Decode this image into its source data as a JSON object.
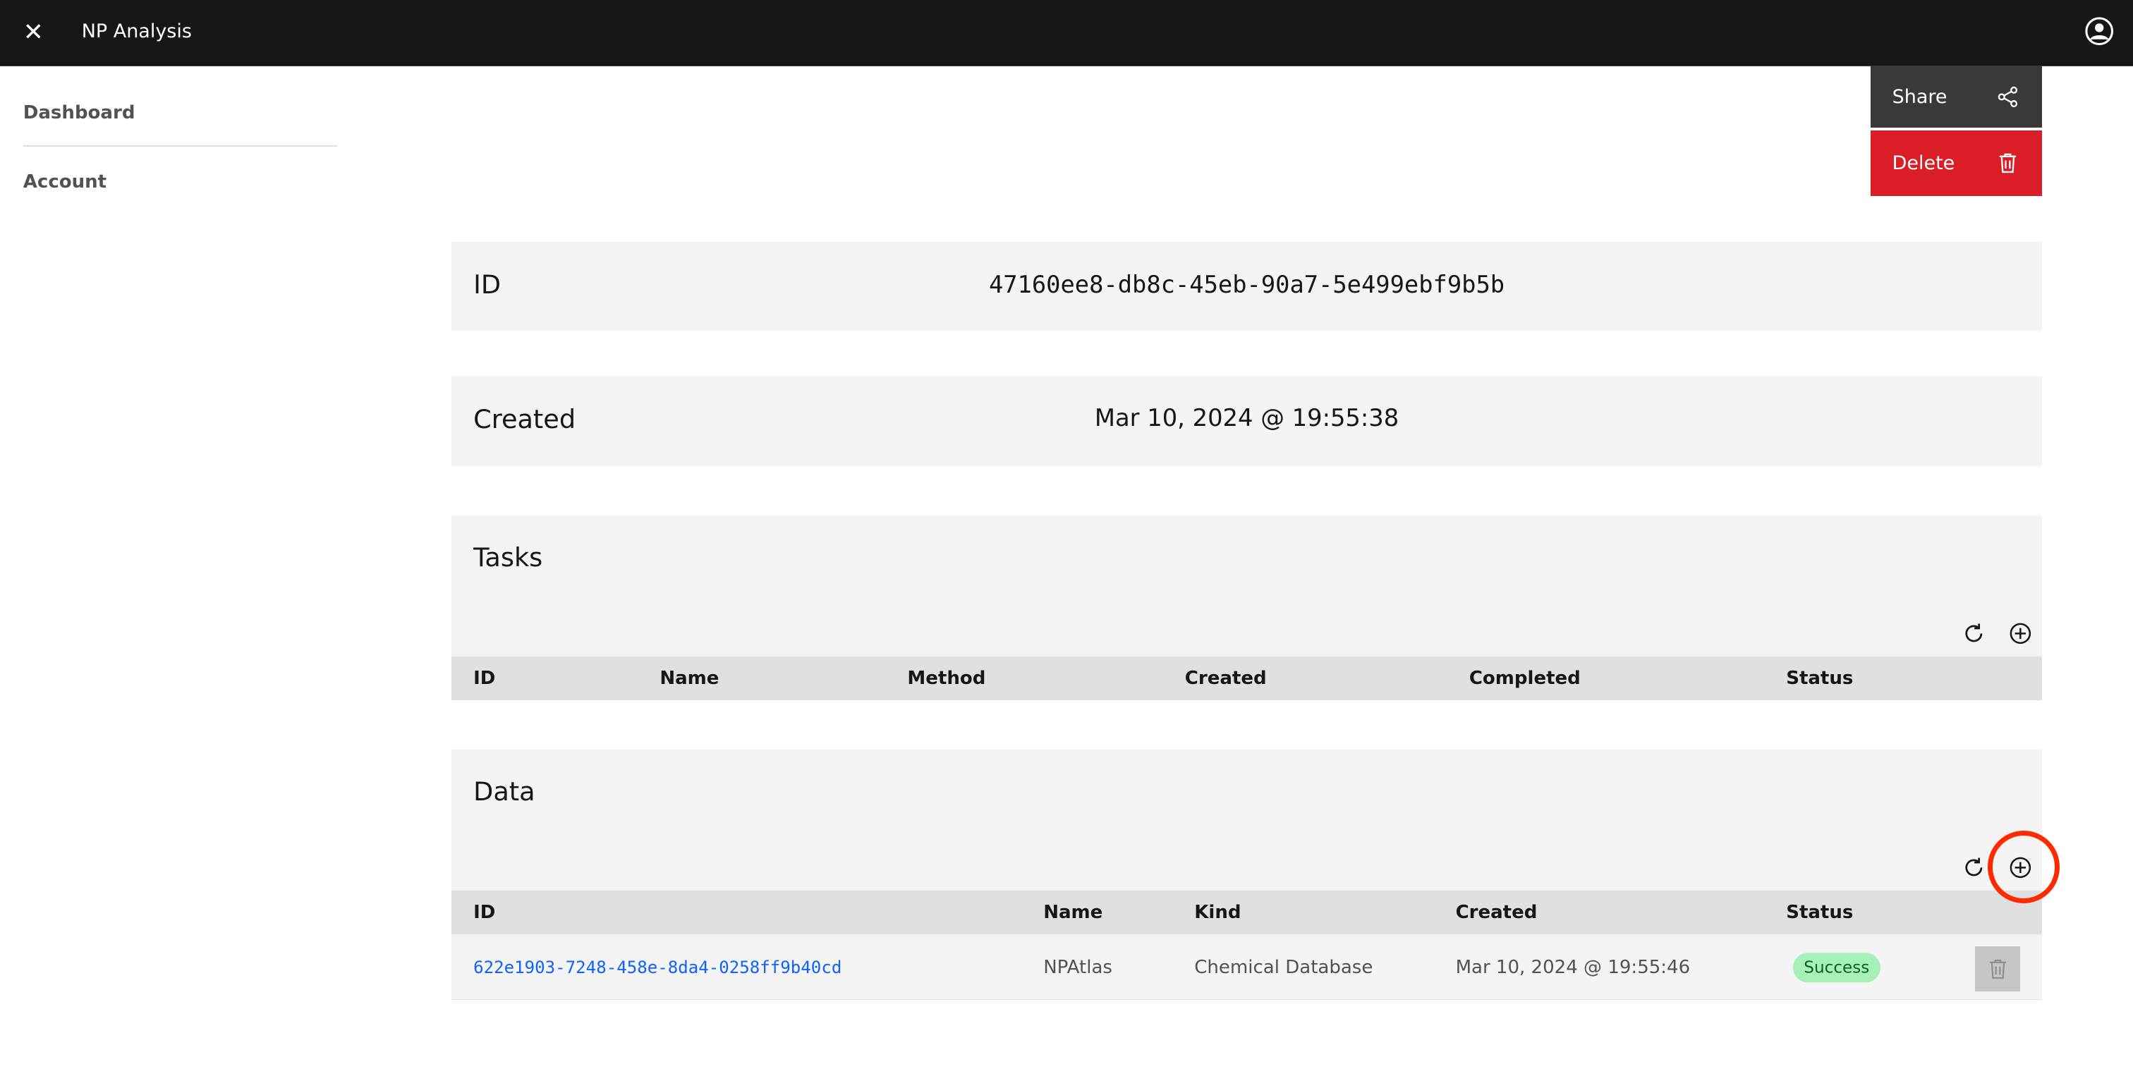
{
  "header": {
    "title": "NP Analysis",
    "close_icon": "close-icon",
    "user_icon": "user-avatar-icon"
  },
  "sidebar": {
    "items": [
      {
        "label": "Dashboard"
      },
      {
        "label": "Account"
      }
    ]
  },
  "actions": {
    "share_label": "Share",
    "delete_label": "Delete",
    "share_icon": "share-icon",
    "delete_icon": "trash-icon",
    "delete_color": "#da1e28"
  },
  "id_card": {
    "label": "ID",
    "value": "47160ee8-db8c-45eb-90a7-5e499ebf9b5b"
  },
  "created_card": {
    "label": "Created",
    "value": "Mar 10, 2024 @ 19:55:38"
  },
  "tasks": {
    "title": "Tasks",
    "columns": [
      "ID",
      "Name",
      "Method",
      "Created",
      "Completed",
      "Status"
    ],
    "rows": []
  },
  "data": {
    "title": "Data",
    "columns": [
      "ID",
      "Name",
      "Kind",
      "Created",
      "Status"
    ],
    "rows": [
      {
        "id": "622e1903-7248-458e-8da4-0258ff9b40cd",
        "name": "NPAtlas",
        "kind": "Chemical Database",
        "created": "Mar 10, 2024 @ 19:55:46",
        "status": "Success"
      }
    ]
  },
  "annotation": {
    "highlight": "data-add-button",
    "color": "#ff2a00"
  }
}
